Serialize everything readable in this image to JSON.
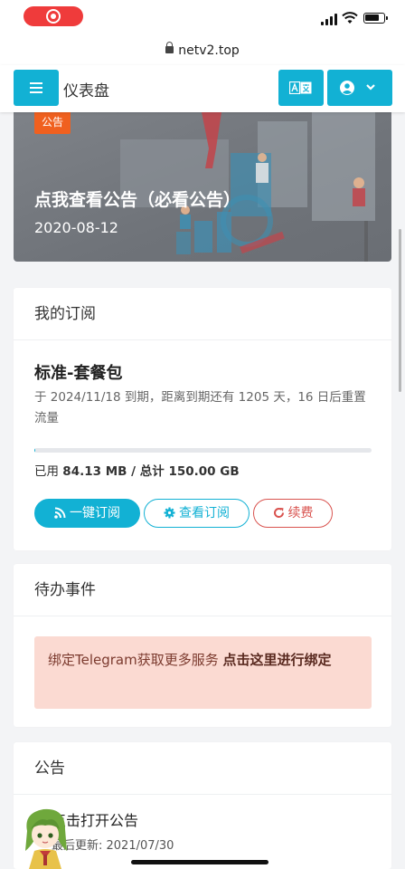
{
  "browser": {
    "url": "netv2.top"
  },
  "header": {
    "title": "仪表盘",
    "lang_icon": "translate-icon",
    "user_icon": "user-icon"
  },
  "banner": {
    "tag": "公告",
    "title": "点我查看公告（必看公告）",
    "date": "2020-08-12"
  },
  "subscription": {
    "heading": "我的订阅",
    "plan_name": "标准-套餐包",
    "description": "于 2024/11/18 到期，距离到期还有 1205 天，16 日后重置流量",
    "usage_prefix": "已用 ",
    "used": "84.13 MB",
    "usage_sep": " / 总计 ",
    "total": "150.00 GB",
    "usage_fraction": 0.0005,
    "buttons": {
      "one_click": "一键订阅",
      "view": "查看订阅",
      "renew": "续费"
    }
  },
  "todo": {
    "heading": "待办事件",
    "alert_text": "绑定Telegram获取更多服务 ",
    "alert_link": "点击这里进行绑定"
  },
  "announcements": {
    "heading": "公告",
    "item_title": "点击打开公告",
    "item_updated": "最后更新: 2021/07/30"
  },
  "colors": {
    "primary": "#12b1d4",
    "danger": "#d9534f",
    "tag": "#f0601f",
    "alert_bg": "#fbdad2"
  }
}
